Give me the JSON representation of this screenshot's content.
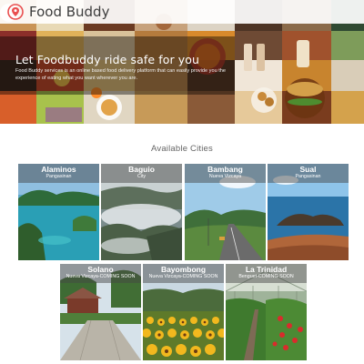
{
  "header": {
    "brand_name": "Food Buddy",
    "logo_icon": "location-pin-icon",
    "accent_color": "#e94f4f"
  },
  "hero": {
    "heading": "Let Foodbuddy ride safe for you",
    "subtext": "Food Buddy services is an online based food delivery platform that can easily provide you the experience of eating what you want wherever you are."
  },
  "cities_section": {
    "title": "Available Cities",
    "cities": [
      {
        "name": "Alaminos",
        "province": "Pangasinan"
      },
      {
        "name": "Baguio",
        "province": "City"
      },
      {
        "name": "Bambang",
        "province": "Nueva Vizcaya"
      },
      {
        "name": "Sual",
        "province": "Pangasinan"
      },
      {
        "name": "Solano",
        "province": "Nueva Vizcaya-COMING SOON"
      },
      {
        "name": "Bayombong",
        "province": "Nueva Vizcaya-COMING SOON"
      },
      {
        "name": "La Trinidad",
        "province": "Benguet-COMING SOON"
      }
    ]
  }
}
